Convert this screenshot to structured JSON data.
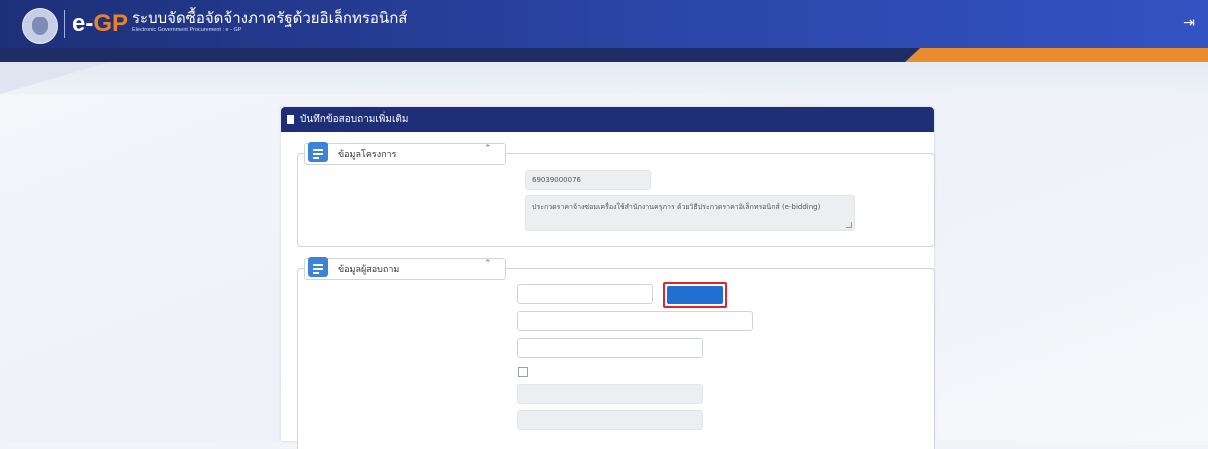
{
  "header": {
    "logo_prefix": "e-",
    "logo_suffix": "GP",
    "app_title": "ระบบจัดซื้อจัดจ้างภาครัฐด้วยอิเล็กทรอนิกส์",
    "app_subtitle": "Electronic Government Procurement : e - GP",
    "date": "",
    "logout_icon": "logout-icon",
    "colors": {
      "header": "#1d2f78",
      "accent": "#ea8c2f",
      "logo_gp": "#e9832a"
    }
  },
  "card": {
    "title": "บันทึกข้อสอบถามเพิ่มเติม",
    "project_section": {
      "label": "ข้อมูลโครงการ",
      "project_no_label": "",
      "project_no": "69039000076",
      "project_name_label": "",
      "project_name": "ประกวดราคาจ้างซ่อมเครื่องใช้สำนักงานครุภาร ด้วยวิธีประกวดราคาอิเล็กทรอนิกส์ (e-bidding)"
    },
    "inquirer_section": {
      "label": "ข้อมูลผู้สอบถาม",
      "id_label": "",
      "id_value": "",
      "check_button": "",
      "email_label": "",
      "email_value": "",
      "name_label": "",
      "name_value": "",
      "checkbox_label": "",
      "tax_id_label": "",
      "tax_id_value": "",
      "juristic_label": "",
      "juristic_value": ""
    }
  }
}
